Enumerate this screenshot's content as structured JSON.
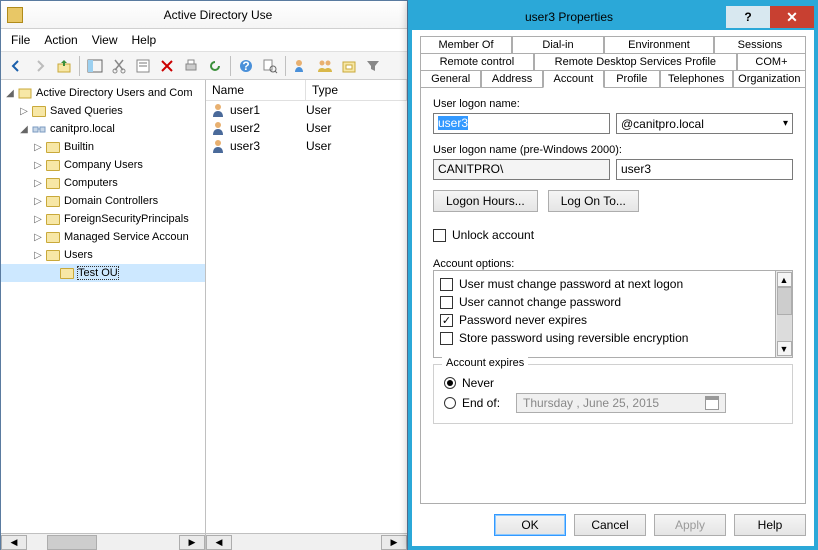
{
  "main": {
    "title": "Active Directory Use",
    "menu": [
      "File",
      "Action",
      "View",
      "Help"
    ],
    "tree": {
      "root": "Active Directory Users and Com",
      "saved": "Saved Queries",
      "domain": "canitpro.local",
      "nodes": [
        "Builtin",
        "Company Users",
        "Computers",
        "Domain Controllers",
        "ForeignSecurityPrincipals",
        "Managed Service Accoun",
        "Users"
      ],
      "selected": "Test OU"
    },
    "list": {
      "cols": {
        "name": "Name",
        "type": "Type"
      },
      "rows": [
        {
          "name": "user1",
          "type": "User"
        },
        {
          "name": "user2",
          "type": "User"
        },
        {
          "name": "user3",
          "type": "User"
        }
      ]
    }
  },
  "dlg": {
    "title": "user3 Properties",
    "tabs_r1": [
      "Member Of",
      "Dial-in",
      "Environment",
      "Sessions"
    ],
    "tabs_r2": [
      "Remote control",
      "Remote Desktop Services Profile",
      "COM+"
    ],
    "tabs_r3": [
      "General",
      "Address",
      "Account",
      "Profile",
      "Telephones",
      "Organization"
    ],
    "logon_label": "User logon name:",
    "logon_value": "user3",
    "logon_suffix": "@canitpro.local",
    "pre2k_label": "User logon name (pre-Windows 2000):",
    "pre2k_domain": "CANITPRO\\",
    "pre2k_user": "user3",
    "btn_hours": "Logon Hours...",
    "btn_logonto": "Log On To...",
    "unlock": "Unlock account",
    "opts_label": "Account options:",
    "opts": [
      {
        "label": "User must change password at next logon",
        "checked": false
      },
      {
        "label": "User cannot change password",
        "checked": false
      },
      {
        "label": "Password never expires",
        "checked": true
      },
      {
        "label": "Store password using reversible encryption",
        "checked": false
      }
    ],
    "expires_label": "Account expires",
    "exp_never": "Never",
    "exp_end": "End of:",
    "exp_date": "Thursday ,    June     25, 2015",
    "buttons": {
      "ok": "OK",
      "cancel": "Cancel",
      "apply": "Apply",
      "help": "Help"
    }
  }
}
